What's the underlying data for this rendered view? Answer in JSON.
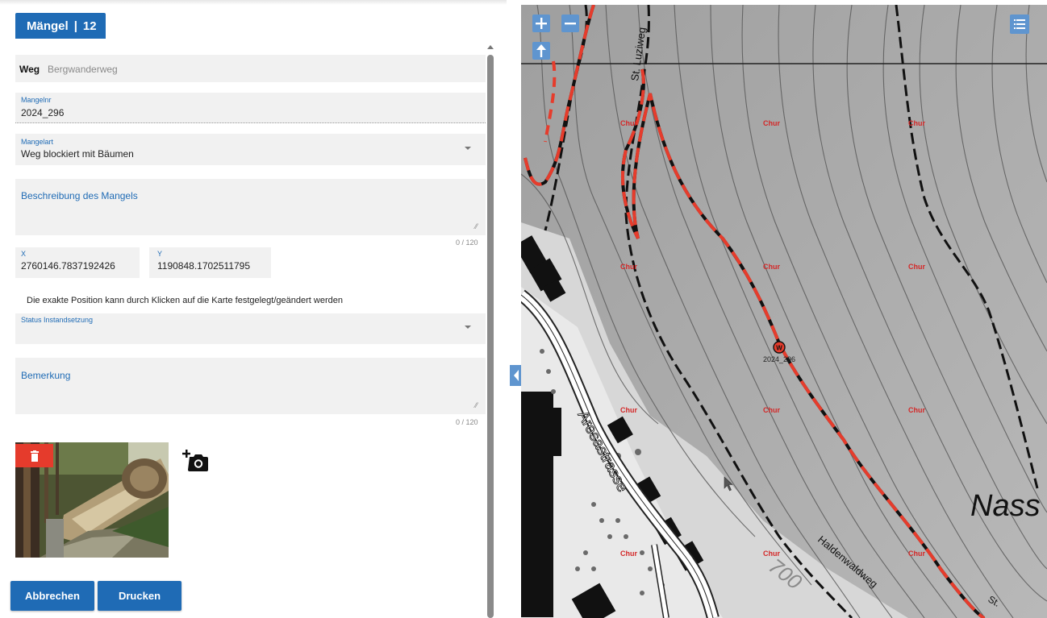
{
  "panel": {
    "tab": {
      "label": "Mängel",
      "count": "12"
    },
    "weg": {
      "label": "Weg",
      "value": "Bergwanderweg"
    },
    "mangelnr": {
      "label": "Mangelnr",
      "value": "2024_296"
    },
    "mangelart": {
      "label": "Mangelart",
      "value": "Weg blockiert mit Bäumen"
    },
    "beschreibung": {
      "placeholder": "Beschreibung des Mangels",
      "counter": "0 / 120"
    },
    "x": {
      "label": "X",
      "value": "2760146.7837192426"
    },
    "y": {
      "label": "Y",
      "value": "1190848.1702511795"
    },
    "hint": "Die exakte Position kann durch Klicken auf die Karte festgelegt/geändert werden",
    "status": {
      "label": "Status Instandsetzung",
      "value": ""
    },
    "bemerkung": {
      "placeholder": "Bemerkung",
      "counter": "0 / 120"
    },
    "buttons": {
      "cancel": "Abbrechen",
      "print": "Drucken"
    }
  },
  "map": {
    "labels": {
      "luziweg": "St. Luziweg",
      "chur": "Chur",
      "arosastrasse": "Arosastrasse",
      "haldenwaldweg": "Haldenwaldweg",
      "nass": "Nass",
      "elevation": "700",
      "marker": "2024_296",
      "marker_symbol": "W",
      "corner": "St."
    }
  },
  "colors": {
    "accent": "#1f6bb5",
    "delete": "#e53b2c",
    "map_button": "#5f95cf",
    "route_red": "#e63c2c"
  }
}
